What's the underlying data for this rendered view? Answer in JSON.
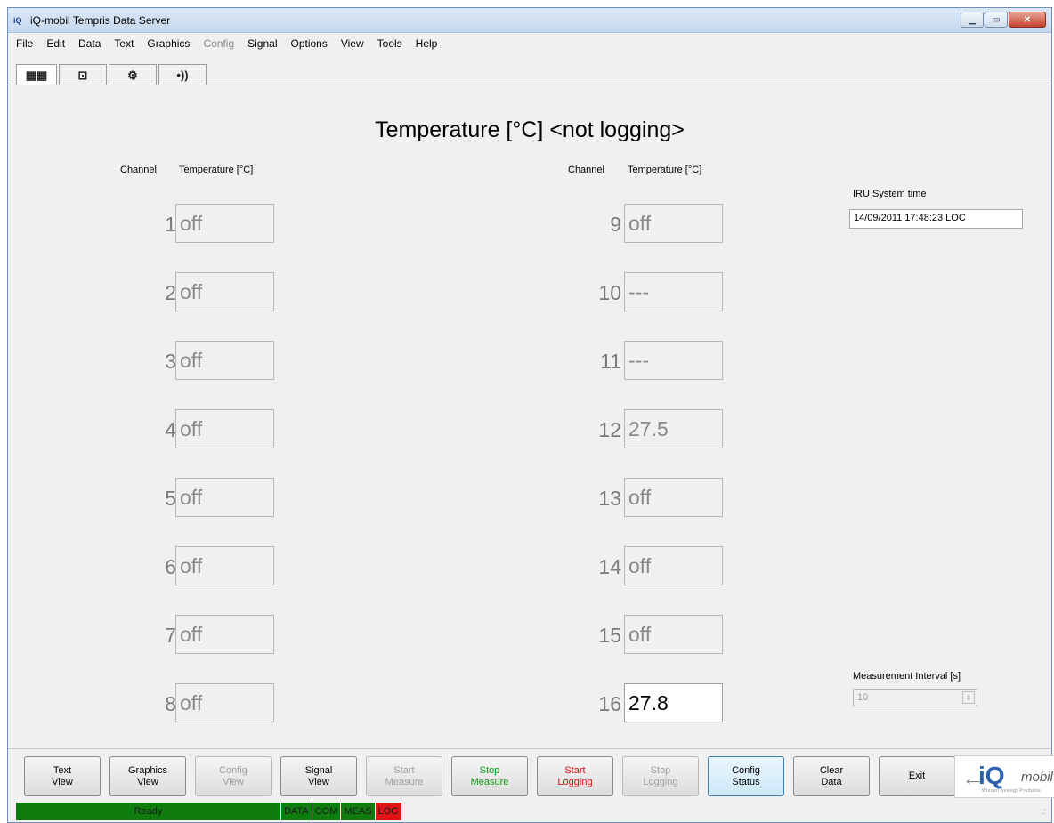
{
  "window": {
    "title": "iQ-mobil Tempris Data Server",
    "minimize_glyph": "▁",
    "maximize_glyph": "▭",
    "close_glyph": "✕"
  },
  "menu": [
    "File",
    "Edit",
    "Data",
    "Text",
    "Graphics",
    "Config",
    "Signal",
    "Options",
    "View",
    "Tools",
    "Help"
  ],
  "menu_disabled": [
    "Config"
  ],
  "toolbar_tabs": [
    {
      "icon": "text-table-icon",
      "glyph": "▦▦"
    },
    {
      "icon": "chart-icon",
      "glyph": "⊡"
    },
    {
      "icon": "config-gears-icon",
      "glyph": "⚙"
    },
    {
      "icon": "signal-icon",
      "glyph": "•))"
    }
  ],
  "main": {
    "title": "Temperature [°C] <not logging>",
    "channel_header": "Channel",
    "temperature_header": "Temperature [°C]",
    "channels": [
      {
        "n": "1",
        "v": "off"
      },
      {
        "n": "2",
        "v": "off"
      },
      {
        "n": "3",
        "v": "off"
      },
      {
        "n": "4",
        "v": "off"
      },
      {
        "n": "5",
        "v": "off"
      },
      {
        "n": "6",
        "v": "off"
      },
      {
        "n": "7",
        "v": "off"
      },
      {
        "n": "8",
        "v": "off"
      },
      {
        "n": "9",
        "v": "off"
      },
      {
        "n": "10",
        "v": "---"
      },
      {
        "n": "11",
        "v": "---"
      },
      {
        "n": "12",
        "v": "27.5"
      },
      {
        "n": "13",
        "v": "off"
      },
      {
        "n": "14",
        "v": "off"
      },
      {
        "n": "15",
        "v": "off"
      },
      {
        "n": "16",
        "v": "27.8"
      }
    ]
  },
  "iru": {
    "label": "IRU System time",
    "value": "14/09/2011 17:48:23 LOC"
  },
  "interval": {
    "label": "Measurement Interval [s]",
    "value": "10"
  },
  "buttons": [
    {
      "label": "Text\nView",
      "state": "normal"
    },
    {
      "label": "Graphics\nView",
      "state": "normal"
    },
    {
      "label": "Config\nView",
      "state": "disabled"
    },
    {
      "label": "Signal\nView",
      "state": "normal"
    },
    {
      "label": "Start\nMeasure",
      "state": "disabled"
    },
    {
      "label": "Stop\nMeasure",
      "state": "green"
    },
    {
      "label": "Start\nLogging",
      "state": "red"
    },
    {
      "label": "Stop\nLogging",
      "state": "disabled"
    },
    {
      "label": "Config\nStatus",
      "state": "focus"
    },
    {
      "label": "Clear\nData",
      "state": "normal"
    },
    {
      "label": "Exit",
      "state": "normal"
    }
  ],
  "logo": {
    "arrow": "←",
    "iq": "iQ",
    "mobil": "mobil",
    "tagline": "Wissen bewegt Produkte"
  },
  "status": {
    "ready": "Ready",
    "data": "DATA",
    "com": "COM",
    "meas": "MEAS",
    "log": "LOG",
    "grip": ".:"
  },
  "colors": {
    "status_green": "#0e7d0e",
    "status_red": "#e01414",
    "button_green": "#119911",
    "button_red": "#e01010"
  }
}
